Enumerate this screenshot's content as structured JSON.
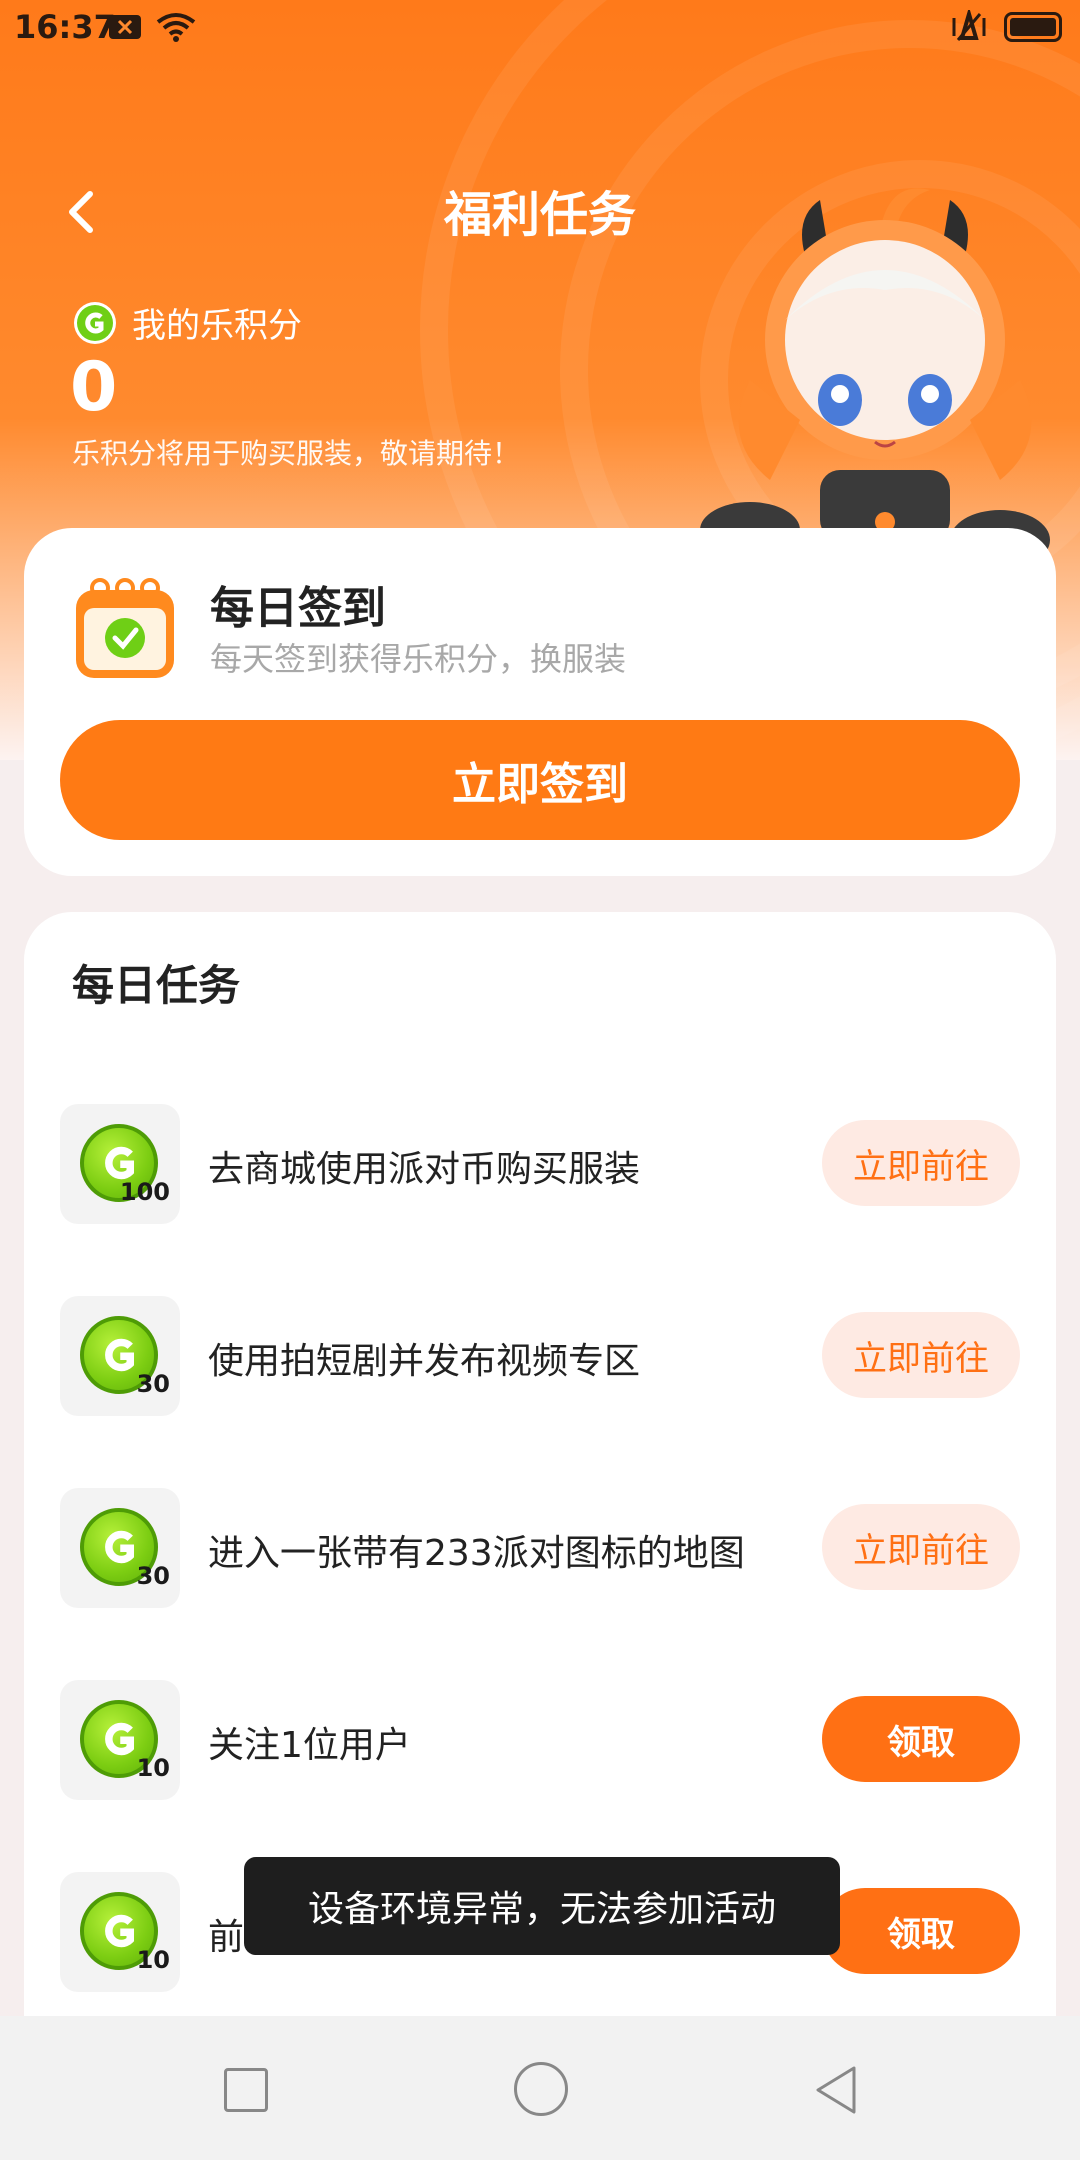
{
  "status_bar": {
    "time": "16:37"
  },
  "header": {
    "title": "福利任务"
  },
  "points": {
    "label": "我的乐积分",
    "value": "0",
    "note": "乐积分将用于购买服装，敬请期待！"
  },
  "signin": {
    "title": "每日签到",
    "subtitle": "每天签到获得乐积分，换服装",
    "button": "立即签到"
  },
  "tasks": {
    "title": "每日任务",
    "items": [
      {
        "reward": "100",
        "name": "去商城使用派对币购买服装",
        "button": "立即前往",
        "button_type": "go"
      },
      {
        "reward": "30",
        "name": "使用拍短剧并发布视频专区",
        "button": "立即前往",
        "button_type": "go"
      },
      {
        "reward": "30",
        "name": "进入一张带有233派对图标的地图",
        "button": "立即前往",
        "button_type": "go"
      },
      {
        "reward": "10",
        "name": "关注1位用户",
        "button": "领取",
        "button_type": "claim"
      },
      {
        "reward": "10",
        "name": "前",
        "button": "领取",
        "button_type": "claim"
      }
    ]
  },
  "toast": {
    "message": "设备环境异常，无法参加活动"
  },
  "colors": {
    "accent": "#ff7014",
    "coin_green": "#7ccd12",
    "go_button_bg": "#feeae3"
  },
  "icons": [
    "back-arrow-icon",
    "g-coin-icon",
    "calendar-check-icon",
    "nav-square-icon",
    "nav-circle-icon",
    "nav-back-icon"
  ]
}
